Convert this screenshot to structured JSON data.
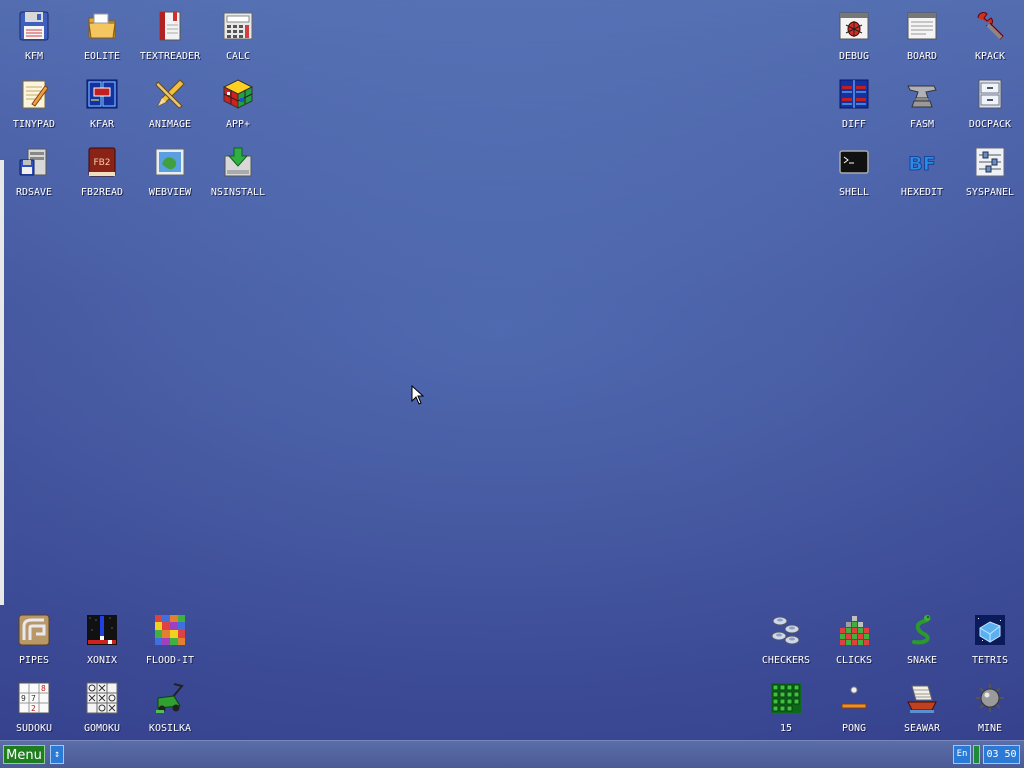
{
  "desktop": {
    "icons_top_left": [
      {
        "name": "kfm",
        "label": "KFM",
        "icon": "floppy-disk-icon"
      },
      {
        "name": "eolite",
        "label": "EOLITE",
        "icon": "folder-icon"
      },
      {
        "name": "textreader",
        "label": "TEXTREADER",
        "icon": "book-icon"
      },
      {
        "name": "calc",
        "label": "CALC",
        "icon": "calculator-icon"
      },
      {
        "name": "tinypad",
        "label": "TINYPAD",
        "icon": "notepad-icon"
      },
      {
        "name": "kfar",
        "label": "KFAR",
        "icon": "dual-panel-icon"
      },
      {
        "name": "animage",
        "label": "ANIMAGE",
        "icon": "pencil-ruler-icon"
      },
      {
        "name": "appplus",
        "label": "APP+",
        "icon": "rubik-cube-icon"
      },
      {
        "name": "rdsave",
        "label": "RDSAVE",
        "icon": "server-disk-icon"
      },
      {
        "name": "fb2read",
        "label": "FB2READ",
        "icon": "fb2-book-icon"
      },
      {
        "name": "webview",
        "label": "WEBVIEW",
        "icon": "globe-window-icon"
      },
      {
        "name": "nsinstall",
        "label": "NSINSTALL",
        "icon": "install-download-icon"
      }
    ],
    "icons_top_right": [
      {
        "name": "debug",
        "label": "DEBUG",
        "icon": "bug-window-icon"
      },
      {
        "name": "board",
        "label": "BOARD",
        "icon": "text-window-icon"
      },
      {
        "name": "kpack",
        "label": "KPACK",
        "icon": "wrench-icon"
      },
      {
        "name": "diff",
        "label": "DIFF",
        "icon": "compare-grid-icon"
      },
      {
        "name": "fasm",
        "label": "FASM",
        "icon": "anvil-icon"
      },
      {
        "name": "docpack",
        "label": "DOCPACK",
        "icon": "cabinet-icon"
      },
      {
        "name": "shell",
        "label": "SHELL",
        "icon": "terminal-icon"
      },
      {
        "name": "hexedit",
        "label": "HEXEDIT",
        "icon": "hex-bf-icon"
      },
      {
        "name": "syspanel",
        "label": "SYSPANEL",
        "icon": "sliders-icon"
      }
    ],
    "icons_bottom_left": [
      {
        "name": "pipes",
        "label": "PIPES",
        "icon": "pipes-icon"
      },
      {
        "name": "xonix",
        "label": "XONIX",
        "icon": "xonix-icon"
      },
      {
        "name": "flood-it",
        "label": "FLOOD-IT",
        "icon": "color-grid-icon"
      },
      {
        "name": "sudoku",
        "label": "SUDOKU",
        "icon": "sudoku-grid-icon"
      },
      {
        "name": "gomoku",
        "label": "GOMOKU",
        "icon": "tic-tac-toe-icon"
      },
      {
        "name": "kosilka",
        "label": "KOSILKA",
        "icon": "lawnmower-icon"
      }
    ],
    "icons_bottom_right": [
      {
        "name": "checkers",
        "label": "CHECKERS",
        "icon": "checkers-pieces-icon"
      },
      {
        "name": "clicks",
        "label": "CLICKS",
        "icon": "blocks-icon"
      },
      {
        "name": "snake",
        "label": "SNAKE",
        "icon": "snake-icon"
      },
      {
        "name": "tetris",
        "label": "TETRIS",
        "icon": "tetris-block-icon"
      },
      {
        "name": "fifteen",
        "label": "15",
        "icon": "green-grid-icon"
      },
      {
        "name": "pong",
        "label": "PONG",
        "icon": "paddle-ball-icon"
      },
      {
        "name": "seawar",
        "label": "SEAWAR",
        "icon": "ship-icon"
      },
      {
        "name": "mine",
        "label": "MINE",
        "icon": "mine-icon"
      }
    ]
  },
  "taskbar": {
    "menu_label": "Menu",
    "scroll_glyph": "↕",
    "language": "En",
    "clock": "03 50"
  },
  "colors": {
    "desktop_top": "#6f93cf",
    "desktop_bottom": "#3a4690",
    "taskbar": "#4f609b",
    "menu_button": "#1f7d1f",
    "tray_button": "#2a7ad6"
  }
}
